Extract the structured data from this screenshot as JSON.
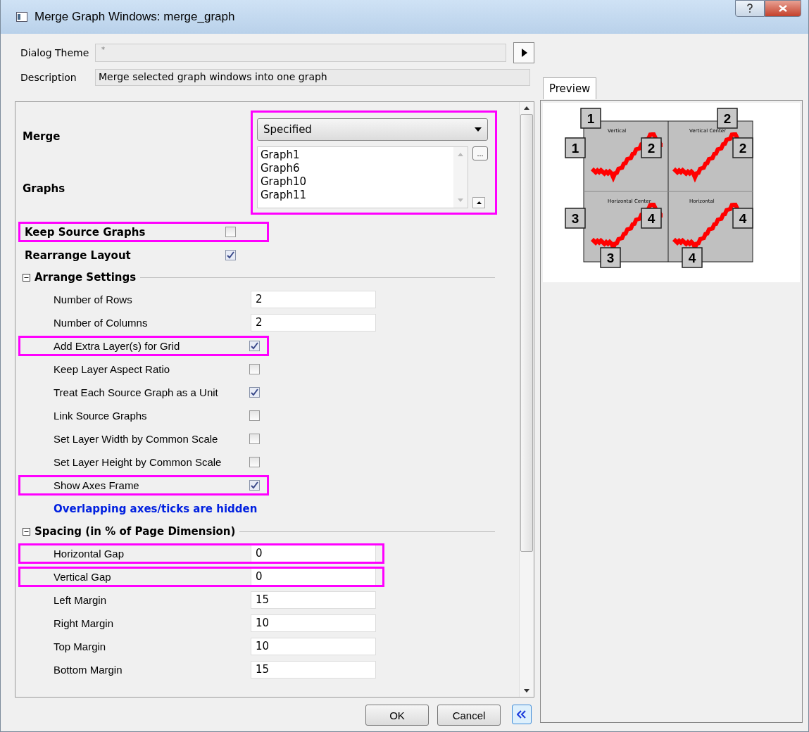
{
  "window": {
    "title": "Merge Graph Windows: merge_graph"
  },
  "theme": {
    "label": "Dialog Theme",
    "value": "*"
  },
  "description": {
    "label": "Description",
    "value": "Merge selected graph windows into one graph"
  },
  "merge": {
    "label": "Merge",
    "value": "Specified",
    "highlighted": true
  },
  "graphs": {
    "label": "Graphs",
    "browse": "...",
    "items": [
      "Graph1",
      "Graph6",
      "Graph10",
      "Graph11"
    ]
  },
  "rows": [
    {
      "kind": "checkbox",
      "label": "Keep Source Graphs",
      "checked": false,
      "highlighted": true
    },
    {
      "kind": "checkbox",
      "label": "Rearrange Layout",
      "checked": true,
      "highlighted": false
    },
    {
      "kind": "section",
      "label": "Arrange Settings",
      "expanded": true,
      "children": [
        {
          "kind": "text",
          "label": "Number of Rows",
          "value": "2",
          "highlighted": false
        },
        {
          "kind": "text",
          "label": "Number of Columns",
          "value": "2",
          "highlighted": false
        },
        {
          "kind": "checkbox",
          "label": "Add Extra Layer(s) for Grid",
          "checked": true,
          "highlighted": true
        },
        {
          "kind": "checkbox",
          "label": "Keep Layer Aspect Ratio",
          "checked": false,
          "highlighted": false
        },
        {
          "kind": "checkbox",
          "label": "Treat Each Source Graph as a Unit",
          "checked": true,
          "highlighted": false
        },
        {
          "kind": "checkbox",
          "label": "Link Source Graphs",
          "checked": false,
          "highlighted": false
        },
        {
          "kind": "checkbox",
          "label": "Set Layer Width by Common Scale",
          "checked": false,
          "highlighted": false
        },
        {
          "kind": "checkbox",
          "label": "Set Layer Height by Common Scale",
          "checked": false,
          "highlighted": false
        },
        {
          "kind": "checkbox",
          "label": "Show Axes Frame",
          "checked": true,
          "highlighted": true
        },
        {
          "kind": "note",
          "label": "Overlapping axes/ticks are hidden"
        }
      ]
    },
    {
      "kind": "section",
      "label": "Spacing (in % of Page Dimension)",
      "expanded": true,
      "children": [
        {
          "kind": "text",
          "label": "Horizontal Gap",
          "value": "0",
          "highlighted": true
        },
        {
          "kind": "text",
          "label": "Vertical Gap",
          "value": "0",
          "highlighted": true
        },
        {
          "kind": "text",
          "label": "Left Margin",
          "value": "15",
          "highlighted": false
        },
        {
          "kind": "text",
          "label": "Right Margin",
          "value": "10",
          "highlighted": false
        },
        {
          "kind": "text",
          "label": "Top Margin",
          "value": "10",
          "highlighted": false
        },
        {
          "kind": "text",
          "label": "Bottom Margin",
          "value": "15",
          "highlighted": false
        }
      ]
    }
  ],
  "buttons": [
    "OK",
    "Cancel"
  ],
  "preview": {
    "tab": "Preview",
    "panels": [
      {
        "title": "Vertical",
        "badges": [
          "1",
          "1",
          "2"
        ]
      },
      {
        "title": "Vertical Center",
        "badges": [
          "2",
          "2"
        ]
      },
      {
        "title": "Horizontal Center",
        "badges": [
          "3",
          "4",
          "3"
        ]
      },
      {
        "title": "Horizontal",
        "badges": [
          "4",
          "4"
        ]
      }
    ]
  }
}
